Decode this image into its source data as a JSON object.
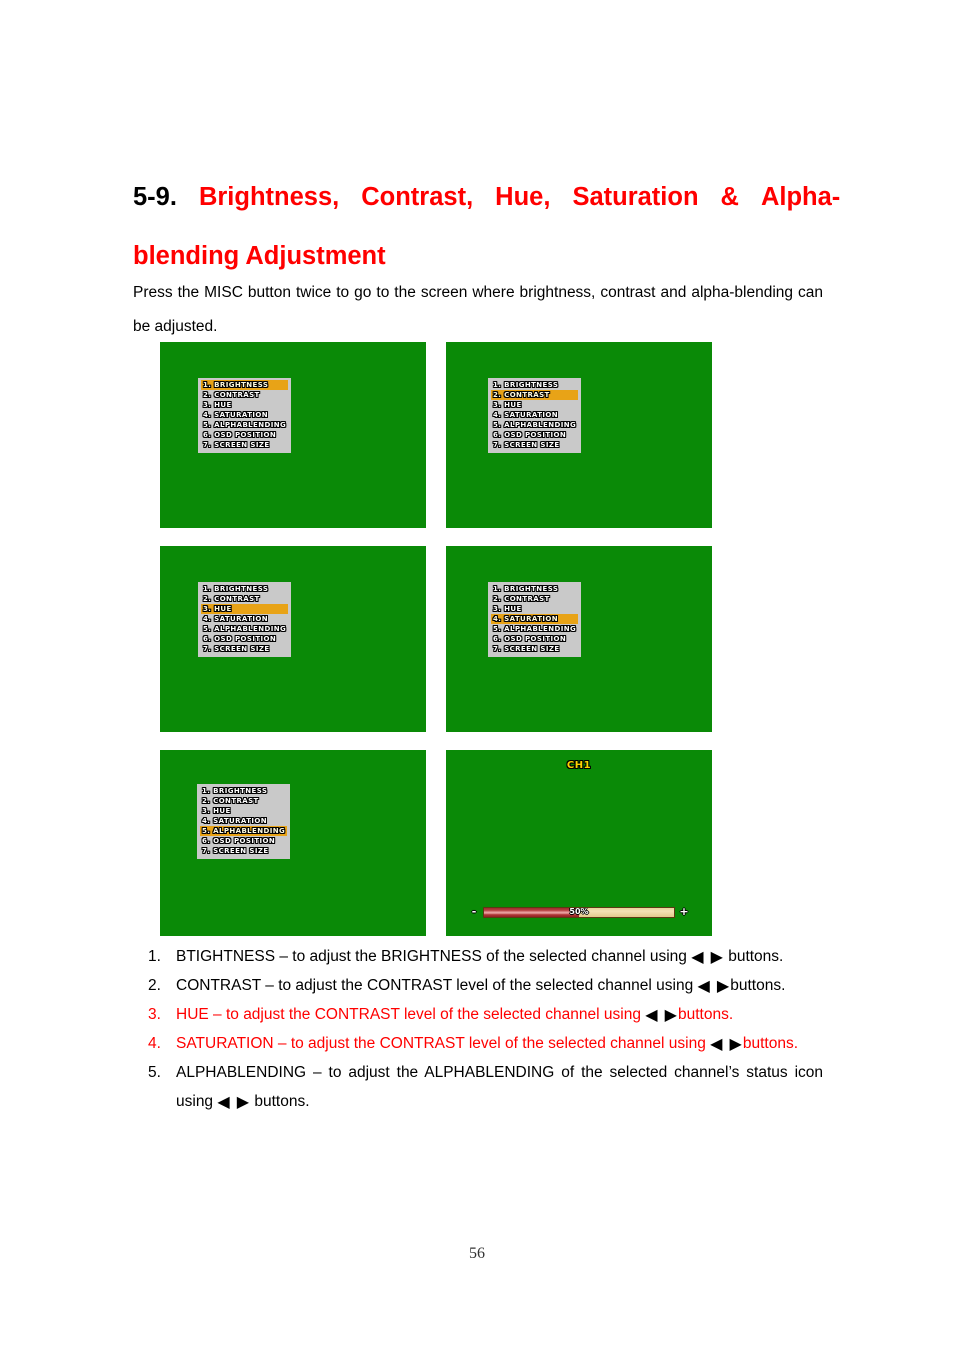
{
  "document": {
    "page_number": "56"
  },
  "heading": {
    "section_number": "5-9.",
    "line1_words": [
      "Brightness,",
      "Contrast,",
      "Hue,",
      "Saturation",
      "&",
      "Alpha-"
    ],
    "line2": "blending Adjustment"
  },
  "intro": {
    "text": "Press the MISC button twice to go to the screen where brightness, contrast and alpha-blending can be adjusted."
  },
  "osd": {
    "menu_items": [
      "1. BRIGHTNESS",
      "2. CONTRAST",
      "3. HUE",
      "4. SATURATION",
      "5. ALPHABLENDING",
      "6. OSD POSITION",
      "7. SCREEN SIZE"
    ],
    "background_color": "#0a8a07",
    "menu_panel_color": "#c9c9c9",
    "highlight_color": "#e8a317",
    "text_color": "#ffffff"
  },
  "screens": [
    {
      "id": "screen-brightness-selected",
      "selected_index": 0
    },
    {
      "id": "screen-contrast-selected",
      "selected_index": 1
    },
    {
      "id": "screen-hue-selected",
      "selected_index": 2
    },
    {
      "id": "screen-saturation-selected",
      "selected_index": 3
    },
    {
      "id": "screen-alphablending-selected",
      "selected_index": 4
    }
  ],
  "channel_screen": {
    "channel_label": "CH1",
    "channel_label_color": "#ffd400",
    "slider": {
      "minus_label": "-",
      "plus_label": "+",
      "value_label": "50%",
      "value_percent": 50,
      "fill_color": "#b03636",
      "track_color": "#ecd69c"
    }
  },
  "notes": [
    {
      "number": "1.",
      "before": "BTIGHTNESS – to adjust the BRIGHTNESS of the selected channel using",
      "arrows": "◀ ▶",
      "after": "buttons.",
      "color": "black",
      "justify": false,
      "space_before_after": true
    },
    {
      "number": "2.",
      "before": "CONTRAST – to adjust the CONTRAST level of the selected channel using",
      "arrows": "◀ ▶",
      "after": "buttons.",
      "color": "black",
      "justify": false,
      "space_before_after": false
    },
    {
      "number": "3.",
      "before": "HUE – to adjust the CONTRAST level of the selected channel using",
      "arrows": "◀ ▶",
      "after": "buttons.",
      "color": "red",
      "justify": false,
      "space_before_after": false
    },
    {
      "number": "4.",
      "before": "SATURATION – to adjust the CONTRAST level of the selected channel using",
      "arrows": "◀ ▶",
      "after": "buttons.",
      "color": "red",
      "justify": true,
      "space_before_after": false
    },
    {
      "number": "5.",
      "before": "ALPHABLENDING – to adjust the ALPHABLENDING of the selected channel’s status icon using",
      "arrows": "◀ ▶",
      "after": "buttons.",
      "color": "black",
      "justify": true,
      "space_before_after": true
    }
  ]
}
